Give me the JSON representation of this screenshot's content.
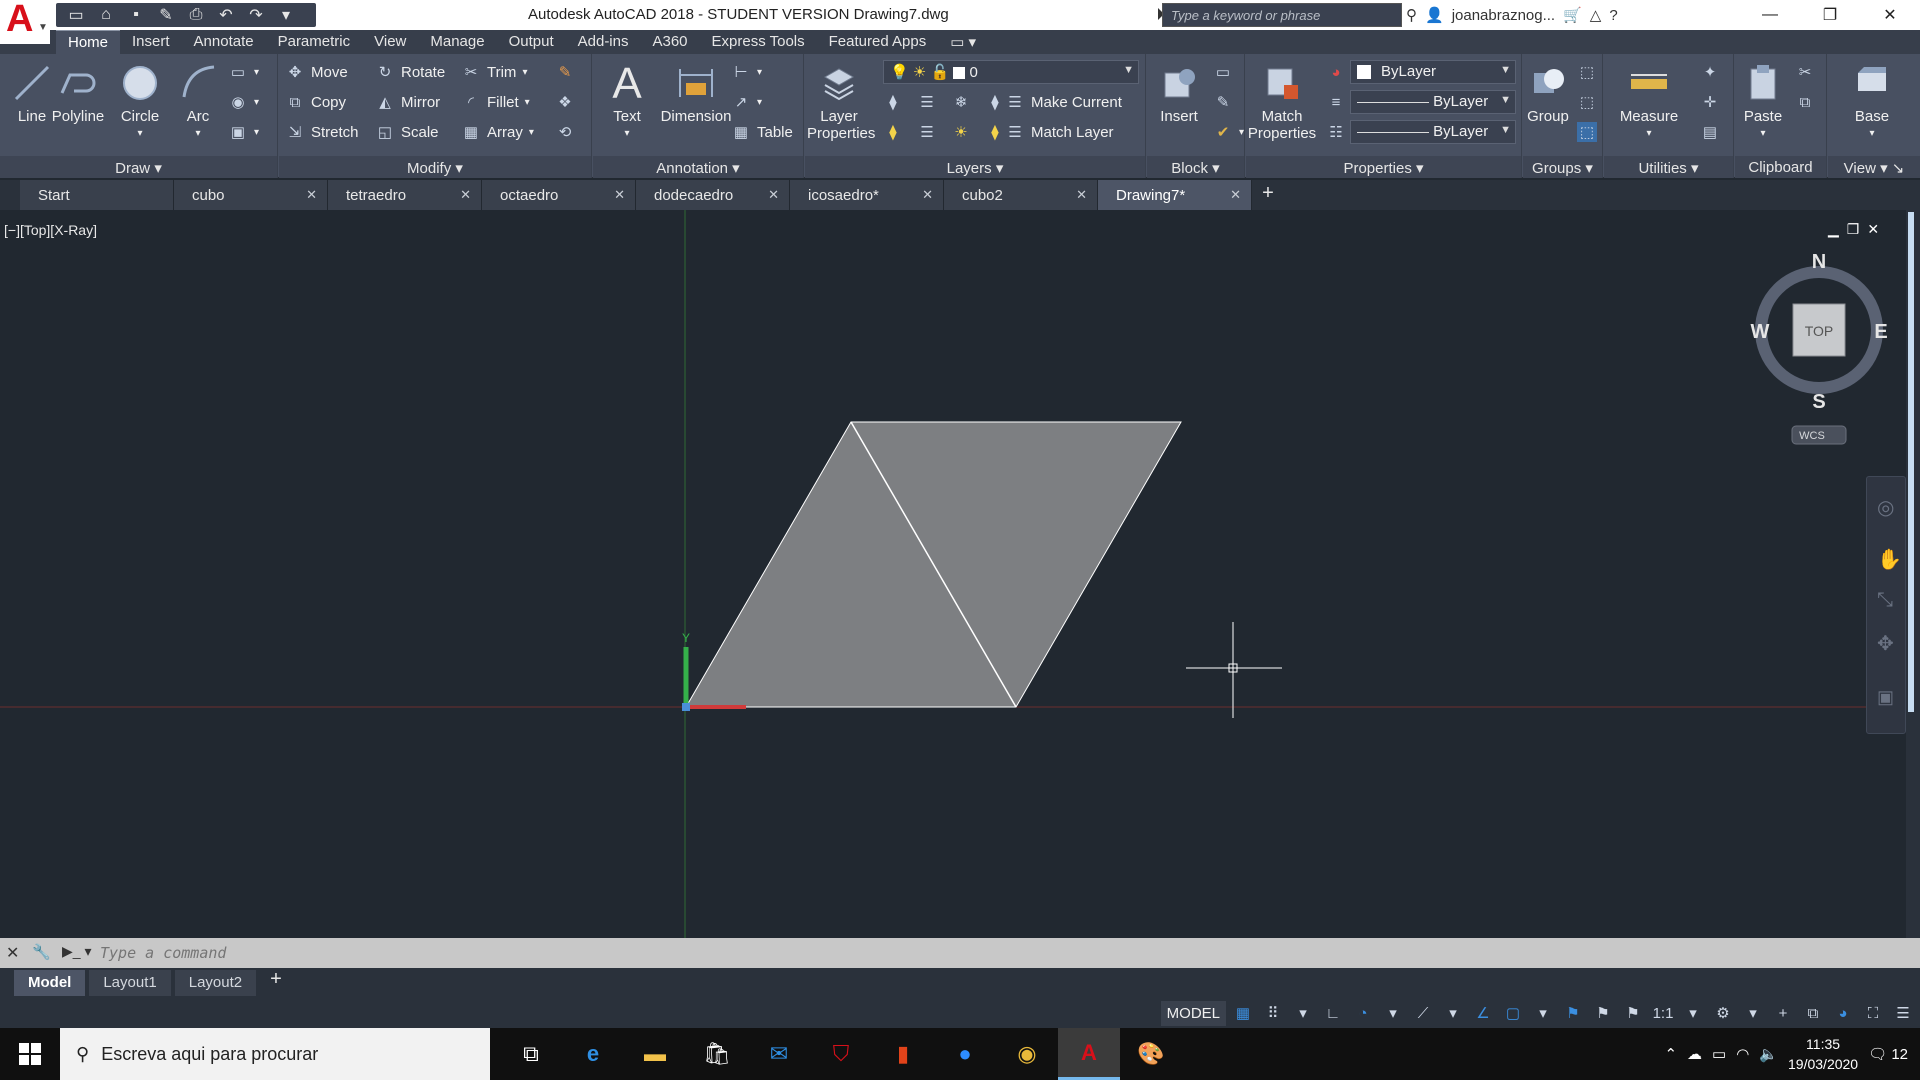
{
  "title": "Autodesk AutoCAD 2018 - STUDENT VERSION    Drawing7.dwg",
  "search_placeholder": "Type a keyword or phrase",
  "user": "joanabraznog...",
  "ribbon_tabs": [
    "Home",
    "Insert",
    "Annotate",
    "Parametric",
    "View",
    "Manage",
    "Output",
    "Add-ins",
    "A360",
    "Express Tools",
    "Featured Apps"
  ],
  "draw": {
    "title": "Draw",
    "line": "Line",
    "polyline": "Polyline",
    "circle": "Circle",
    "arc": "Arc"
  },
  "modify": {
    "title": "Modify",
    "move": "Move",
    "rotate": "Rotate",
    "trim": "Trim",
    "copy": "Copy",
    "mirror": "Mirror",
    "fillet": "Fillet",
    "stretch": "Stretch",
    "scale": "Scale",
    "array": "Array"
  },
  "annotation": {
    "title": "Annotation",
    "text": "Text",
    "dimension": "Dimension",
    "table": "Table"
  },
  "layers": {
    "title": "Layers",
    "layer_properties_1": "Layer",
    "layer_properties_2": "Properties",
    "current_layer": "0",
    "make_current": "Make Current",
    "match_layer": "Match Layer"
  },
  "block": {
    "title": "Block",
    "insert": "Insert"
  },
  "properties": {
    "title": "Properties",
    "match_1": "Match",
    "match_2": "Properties",
    "color": "ByLayer",
    "linetype": "ByLayer",
    "lineweight": "ByLayer"
  },
  "groups": {
    "title": "Groups",
    "group": "Group"
  },
  "utilities": {
    "title": "Utilities",
    "measure": "Measure"
  },
  "clipboard": {
    "title": "Clipboard",
    "paste": "Paste"
  },
  "view_panel": {
    "title": "View",
    "base": "Base"
  },
  "doc_tabs": [
    "Start",
    "cubo",
    "tetraedro",
    "octaedro",
    "dodecaedro",
    "icosaedro*",
    "cubo2",
    "Drawing7*"
  ],
  "viewport_label": "[−][Top][X-Ray]",
  "viewcube": {
    "n": "N",
    "s": "S",
    "e": "E",
    "w": "W",
    "face": "TOP",
    "wcs": "WCS"
  },
  "ucs": {
    "y": "Y"
  },
  "command_placeholder": "Type a command",
  "layout_tabs": [
    "Model",
    "Layout1",
    "Layout2"
  ],
  "status": {
    "model": "MODEL",
    "scale": "1:1"
  },
  "taskbar": {
    "search": "Escreva aqui para procurar",
    "time": "11:35",
    "date": "19/03/2020",
    "notifications": "12"
  },
  "colors": {
    "ribbon": "#485061",
    "canvas": "#212830",
    "shape_fill": "#7d7f82",
    "accent": "#3b8fe0"
  }
}
